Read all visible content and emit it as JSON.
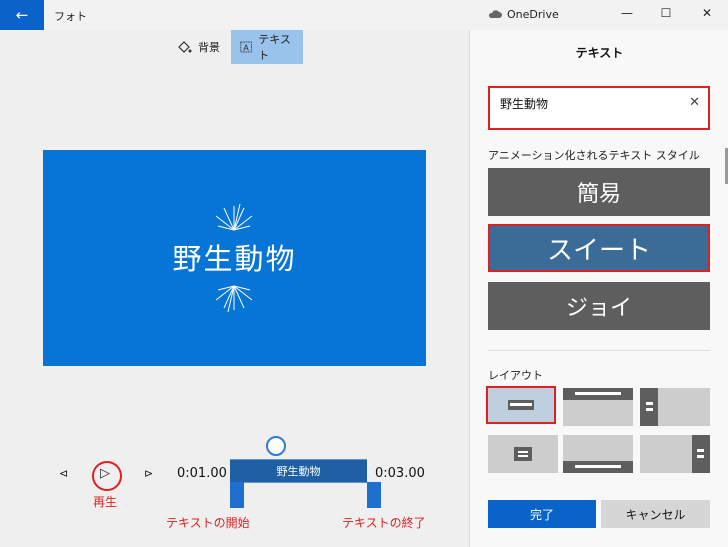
{
  "window": {
    "app_title": "フォト",
    "onedrive_label": "OneDrive",
    "minimize": "—",
    "maximize": "☐",
    "close": "✕"
  },
  "toolbar": {
    "background_label": "背景",
    "text_label": "テキスト"
  },
  "preview": {
    "text": "野生動物"
  },
  "playback": {
    "start_time": "0:01.00",
    "end_time": "0:03.00",
    "track_label": "野生動物"
  },
  "annotations": {
    "play": "再生",
    "text_start": "テキストの開始",
    "text_end": "テキストの終了"
  },
  "panel": {
    "title": "テキスト",
    "text_value": "野生動物",
    "styles_label": "アニメーション化されるテキスト スタイル",
    "styles": [
      "簡易",
      "スイート",
      "ジョイ"
    ],
    "selected_style": "スイート",
    "layout_label": "レイアウト",
    "done_label": "完了",
    "cancel_label": "キャンセル"
  },
  "colors": {
    "accent": "#0a63c9",
    "preview_bg": "#0675d6",
    "annotation_red": "#e02020",
    "selected_style_bg": "#3b6c98"
  }
}
